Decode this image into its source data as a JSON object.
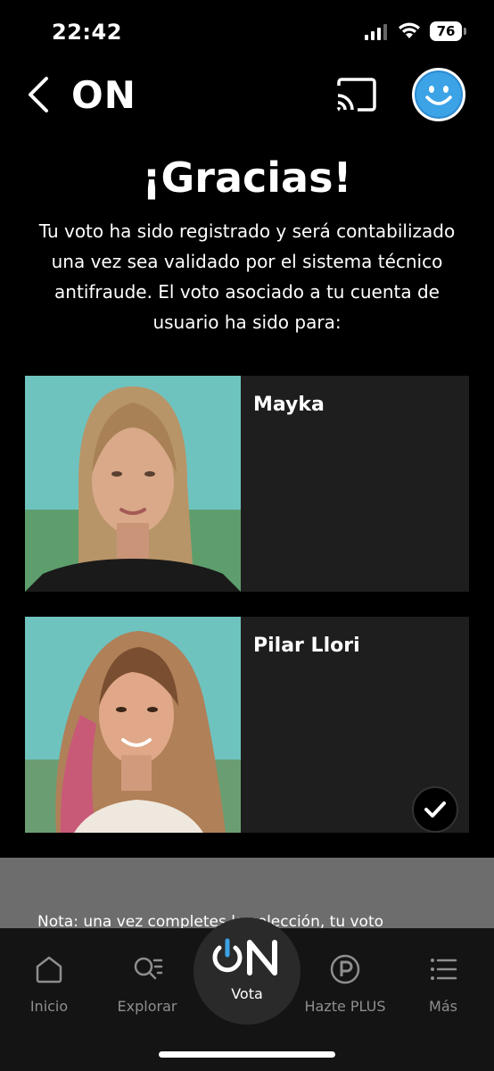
{
  "status": {
    "time": "22:42",
    "battery": "76"
  },
  "header": {
    "title": "ON"
  },
  "thanks": {
    "title": "¡Gracias!",
    "lines": [
      "Tu voto ha sido registrado y será contabilizado",
      "una vez sea validado por el sistema técnico",
      "antifraude. El voto asociado a tu cuenta de",
      "usuario ha sido para:"
    ]
  },
  "candidates": [
    {
      "name": "Mayka",
      "selected": false
    },
    {
      "name": "Pilar Llori",
      "selected": true
    }
  ],
  "note": {
    "text": "Nota: una vez completes la selección, tu voto"
  },
  "nav": {
    "items": [
      {
        "label": "Inicio",
        "icon": "home-icon"
      },
      {
        "label": "Explorar",
        "icon": "search-list-icon"
      },
      {
        "label": "Vota",
        "icon": "on-logo-icon"
      },
      {
        "label": "Hazte PLUS",
        "icon": "plus-badge-icon"
      },
      {
        "label": "Más",
        "icon": "menu-list-icon"
      }
    ]
  },
  "colors": {
    "accent": "#3ba3e6",
    "card_bg": "#1e1e1e",
    "photo_bg": "#6ec3bf"
  }
}
